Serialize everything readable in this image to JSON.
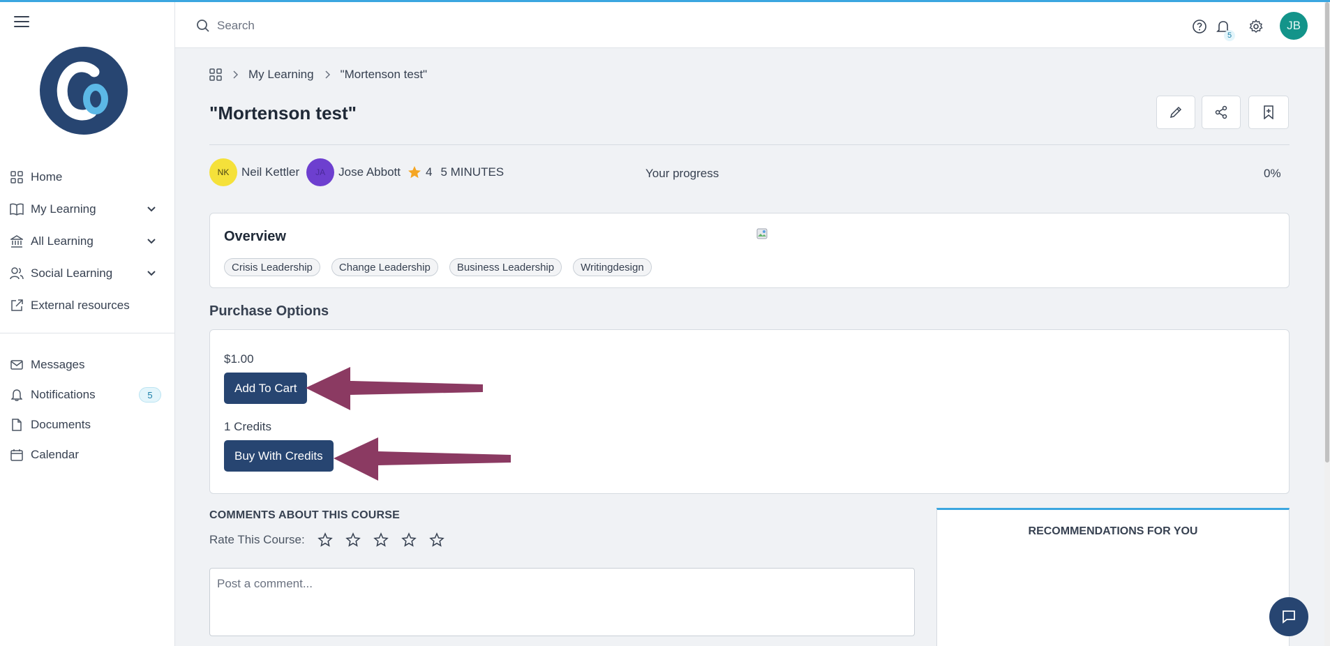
{
  "sidebar": {
    "items": [
      {
        "label": "Home",
        "icon": "grid-icon"
      },
      {
        "label": "My Learning",
        "icon": "book-icon"
      },
      {
        "label": "All Learning",
        "icon": "institution-icon"
      },
      {
        "label": "Social Learning",
        "icon": "users-icon"
      },
      {
        "label": "External resources",
        "icon": "external-link-icon"
      }
    ],
    "secondary": [
      {
        "label": "Messages",
        "icon": "mail-icon"
      },
      {
        "label": "Notifications",
        "icon": "bell-icon",
        "badge": "5"
      },
      {
        "label": "Documents",
        "icon": "document-icon"
      },
      {
        "label": "Calendar",
        "icon": "calendar-icon"
      }
    ]
  },
  "topbar": {
    "search_placeholder": "Search",
    "notification_count": "5",
    "avatar_initials": "JB"
  },
  "breadcrumb": {
    "section": "My Learning",
    "current": "\"Mortenson test\""
  },
  "page": {
    "title": "\"Mortenson test\""
  },
  "meta": {
    "author1_initials": "NK",
    "author1_name": "Neil Kettler",
    "author2_initials": "JA",
    "author2_name": "Jose Abbott",
    "rating": "4",
    "duration": "5 MINUTES",
    "progress_label": "Your progress",
    "progress_value": "0%"
  },
  "overview": {
    "title": "Overview",
    "tags": [
      "Crisis Leadership",
      "Change Leadership",
      "Business Leadership",
      "Writingdesign"
    ]
  },
  "purchase": {
    "title": "Purchase Options",
    "price": "$1.00",
    "add_to_cart_label": "Add To Cart",
    "credits": "1 Credits",
    "buy_with_credits_label": "Buy With Credits"
  },
  "comments": {
    "title": "COMMENTS ABOUT THIS COURSE",
    "rate_label": "Rate This Course:",
    "placeholder": "Post a comment..."
  },
  "recommendations": {
    "title": "RECOMMENDATIONS FOR YOU"
  },
  "colors": {
    "primary_button": "#274571",
    "accent": "#3ba6e0",
    "annotation_arrow": "#8b3a62",
    "avatar_tb": "#13948a"
  }
}
